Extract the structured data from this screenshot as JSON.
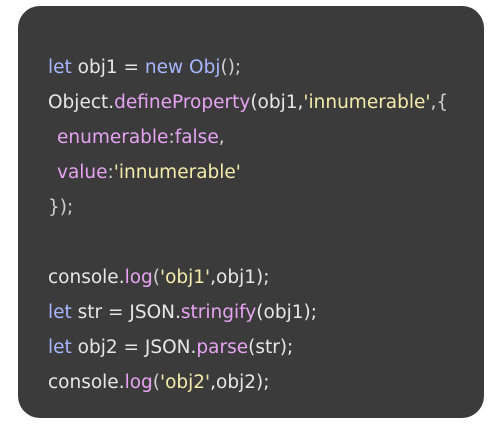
{
  "colors": {
    "background": "#ffffff",
    "card": "#3b3b3b",
    "keyword": "#a6b7ff",
    "function": "#e6a3f2",
    "string": "#f5ebab",
    "text": "#e7e7e7"
  },
  "code": {
    "lines": [
      {
        "tokens": [
          "let",
          " obj1 = ",
          "new",
          " ",
          "Obj",
          "();"
        ]
      },
      {
        "tokens": [
          "Object.",
          "defineProperty",
          "(obj1,",
          "'innumerable'",
          ",{"
        ]
      },
      {
        "tokens": [
          "enumerable",
          ":",
          "false",
          ","
        ]
      },
      {
        "tokens": [
          "value",
          ":",
          "'innumerable'"
        ]
      },
      {
        "tokens": [
          "});"
        ]
      },
      {
        "tokens": [
          "console.",
          "log",
          "(",
          "'obj1'",
          ",obj1);"
        ]
      },
      {
        "tokens": [
          "let",
          " str = JSON.",
          "stringify",
          "(obj1);"
        ]
      },
      {
        "tokens": [
          "let",
          " obj2 = JSON.",
          "parse",
          "(str);"
        ]
      },
      {
        "tokens": [
          "console.",
          "log",
          "(",
          "'obj2'",
          ",obj2);"
        ]
      }
    ]
  }
}
